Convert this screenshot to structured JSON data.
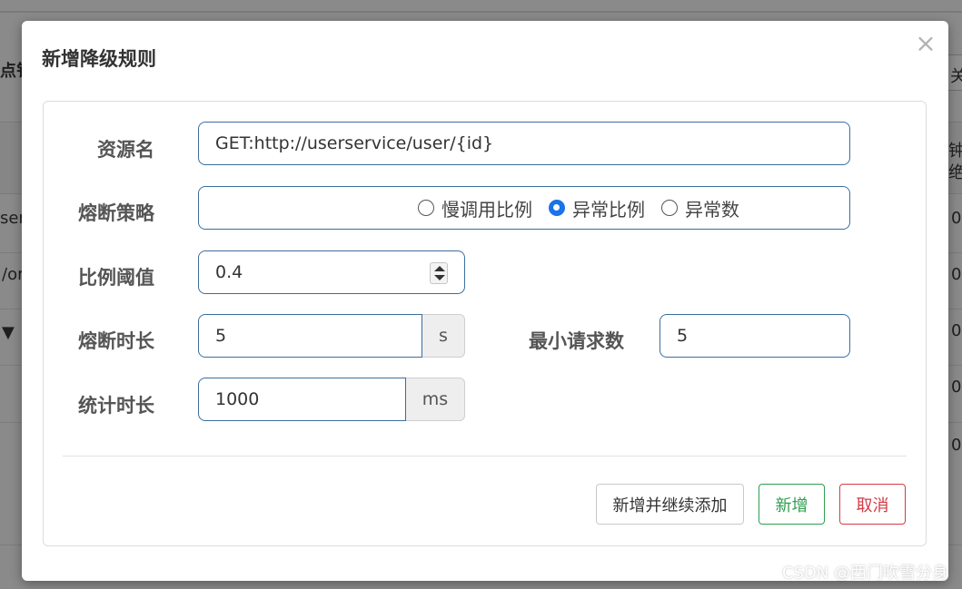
{
  "background": {
    "fragments": {
      "left_top": "点钅",
      "right_top": "关",
      "right_header_1": "钟",
      "right_header_2": "绝",
      "row1_left": "ser",
      "row2_left": "/or",
      "row3_left": "▼",
      "row_value": "0"
    }
  },
  "modal": {
    "title": "新增降级规则",
    "close": "×",
    "fields": {
      "resource_label": "资源名",
      "resource_value": "GET:http://userservice/user/{id}",
      "strategy_label": "熔断策略",
      "strategy_options": [
        "慢调用比例",
        "异常比例",
        "异常数"
      ],
      "strategy_selected": "异常比例",
      "ratio_label": "比例阈值",
      "ratio_value": "0.4",
      "duration_label": "熔断时长",
      "duration_value": "5",
      "duration_unit": "s",
      "min_requests_label": "最小请求数",
      "min_requests_value": "5",
      "stat_label": "统计时长",
      "stat_value": "1000",
      "stat_unit": "ms"
    },
    "buttons": {
      "add_continue": "新增并继续添加",
      "add": "新增",
      "cancel": "取消"
    }
  },
  "watermark": "CSDN @西门吹雪分身",
  "colors": {
    "primary_border": "#3b6e9e",
    "radio_selected": "#1a73e8",
    "success": "#2e9e4f",
    "danger": "#d23b46"
  }
}
